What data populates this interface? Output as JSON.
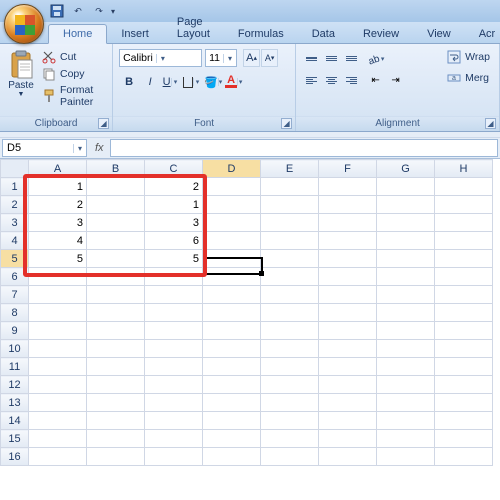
{
  "qat": {
    "save": "save-icon",
    "undo": "undo-icon",
    "redo": "redo-icon"
  },
  "tabs": [
    "Home",
    "Insert",
    "Page Layout",
    "Formulas",
    "Data",
    "Review",
    "View",
    "Acr"
  ],
  "active_tab": 0,
  "clipboard": {
    "paste": "Paste",
    "cut": "Cut",
    "copy": "Copy",
    "format_painter": "Format Painter",
    "group_label": "Clipboard"
  },
  "font": {
    "name": "Calibri",
    "size": "11",
    "group_label": "Font",
    "bold": "B",
    "italic": "I",
    "underline": "U"
  },
  "alignment": {
    "wrap": "Wrap",
    "merge": "Merg",
    "group_label": "Alignment"
  },
  "namebox": "D5",
  "formula": "",
  "columns": [
    "A",
    "B",
    "C",
    "D",
    "E",
    "F",
    "G",
    "H"
  ],
  "total_rows": 16,
  "selected_cell": {
    "col": 3,
    "row": 5
  },
  "data": {
    "0": {
      "1": "1",
      "2": "2",
      "3": "3",
      "4": "4",
      "5": "5"
    },
    "1": {},
    "2": {
      "1": "2",
      "2": "1",
      "3": "3",
      "4": "6",
      "5": "5"
    }
  },
  "highlight": {
    "r1": 1,
    "c1": 0,
    "r2": 5,
    "c2": 2
  }
}
